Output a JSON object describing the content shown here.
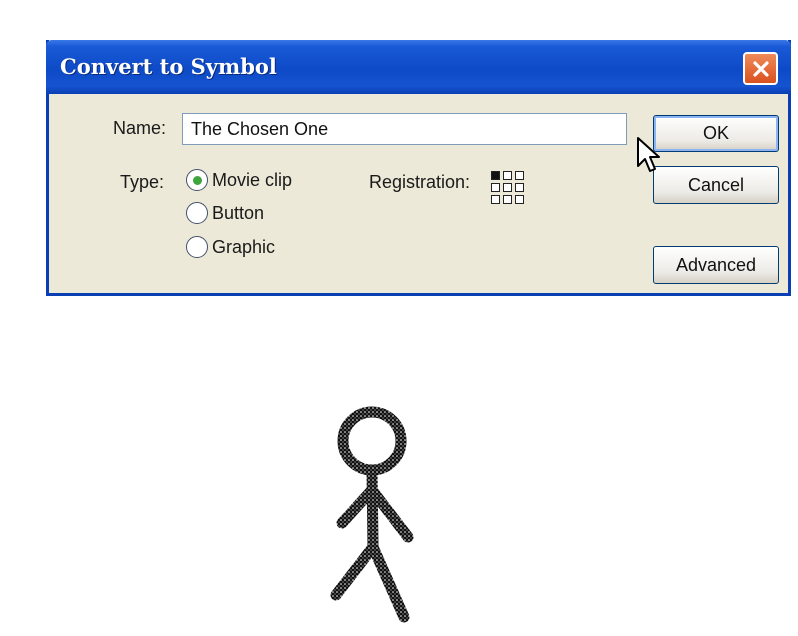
{
  "dialog": {
    "title": "Convert to Symbol",
    "close_icon": "close-x-icon",
    "name_label": "Name:",
    "name_value": "The Chosen One",
    "type_label": "Type:",
    "types": [
      {
        "label": "Movie clip",
        "selected": true
      },
      {
        "label": "Button",
        "selected": false
      },
      {
        "label": "Graphic",
        "selected": false
      }
    ],
    "registration_label": "Registration:",
    "registration_selected": "top-left",
    "buttons": {
      "ok": "OK",
      "cancel": "Cancel",
      "advanced": "Advanced"
    }
  },
  "colors": {
    "titlebar": "#0d4ac8",
    "dialog_bg": "#ece9d8",
    "radio_selected": "#3da63d",
    "close_button": "#d9521e"
  },
  "canvas": {
    "figure": "stick-figure"
  }
}
